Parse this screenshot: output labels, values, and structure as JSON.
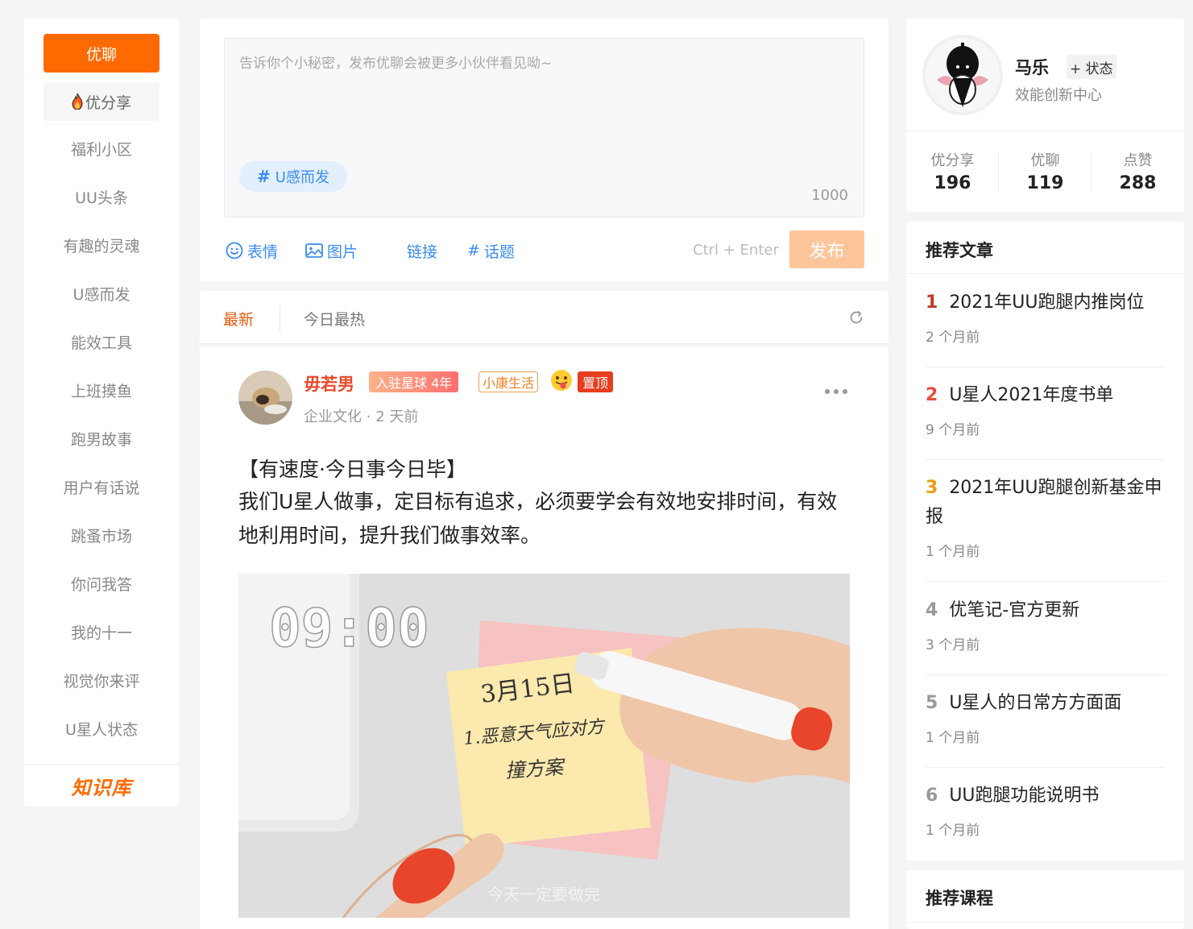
{
  "sidebar": {
    "active": "优聊",
    "share": "优分享",
    "items": [
      "福利小区",
      "UU头条",
      "有趣的灵魂",
      "U感而发",
      "能效工具",
      "上班摸鱼",
      "跑男故事",
      "用户有话说",
      "跳蚤市场",
      "你问我答",
      "我的十一",
      "视觉你来评",
      "U星人状态"
    ],
    "kb_logo": "知识库"
  },
  "composer": {
    "placeholder": "告诉你个小秘密，发布优聊会被更多小伙伴看见呦~",
    "topic_chip": "U感而发",
    "char_count": "1000",
    "tools": {
      "emoji": "表情",
      "image": "图片",
      "link": "链接",
      "topic": "话题"
    },
    "shortcut": "Ctrl + Enter",
    "publish": "发布"
  },
  "feed": {
    "tabs": {
      "latest": "最新",
      "hot": "今日最热"
    }
  },
  "post": {
    "author": "毋若男",
    "badge_year": "入驻星球 4年",
    "badge_tag": "小康生活",
    "badge_pinned": "置顶",
    "category": "企业文化",
    "time": "2 天前",
    "title": "【有速度·今日事今日毕】",
    "body": "我们U星人做事，定目标有追求，必须要学会有效地安排时间，有效地利用时间，提升我们做事效率。",
    "image": {
      "clock": "09:00",
      "note_date": "3月15日",
      "note_line1": "1.恶意天气应对方",
      "note_line2": "撞方案",
      "caption": "今天一定要做完"
    }
  },
  "profile": {
    "name": "马乐",
    "status_button": "+ 状态",
    "department": "效能创新中心",
    "stats": [
      {
        "label": "优分享",
        "value": "196"
      },
      {
        "label": "优聊",
        "value": "119"
      },
      {
        "label": "点赞",
        "value": "288"
      }
    ]
  },
  "recommended_articles": {
    "title": "推荐文章",
    "items": [
      {
        "rank": "1",
        "title": "2021年UU跑腿内推岗位",
        "time": "2 个月前",
        "color": "#c0392b"
      },
      {
        "rank": "2",
        "title": "U星人2021年度书单",
        "time": "9 个月前",
        "color": "#e74c3c"
      },
      {
        "rank": "3",
        "title": "2021年UU跑腿创新基金申报",
        "time": "1 个月前",
        "color": "#f39c12"
      },
      {
        "rank": "4",
        "title": "优笔记-官方更新",
        "time": "3 个月前",
        "color": "#999999"
      },
      {
        "rank": "5",
        "title": "U星人的日常方方面面",
        "time": "1 个月前",
        "color": "#999999"
      },
      {
        "rank": "6",
        "title": "UU跑腿功能说明书",
        "time": "1 个月前",
        "color": "#999999"
      }
    ]
  },
  "recommended_courses": {
    "title": "推荐课程"
  },
  "colors": {
    "accent": "#ff6a00",
    "link": "#3a8cf0",
    "publish_disabled": "#ffc59a",
    "author": "#e84a2b"
  }
}
